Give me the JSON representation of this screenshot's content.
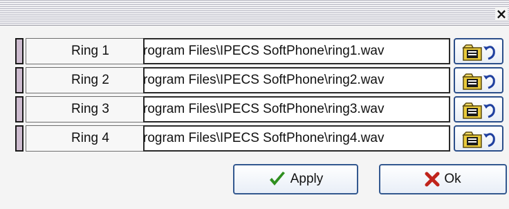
{
  "dialog": {
    "close_glyph": "×"
  },
  "rows": [
    {
      "label": "Ring 1",
      "path": "rogram Files\\IPECS SoftPhone\\ring1.wav"
    },
    {
      "label": "Ring 2",
      "path": "rogram Files\\IPECS SoftPhone\\ring2.wav"
    },
    {
      "label": "Ring 3",
      "path": "rogram Files\\IPECS SoftPhone\\ring3.wav"
    },
    {
      "label": "Ring 4",
      "path": "rogram Files\\IPECS SoftPhone\\ring4.wav"
    }
  ],
  "icons": {
    "browse": "folder-browse-icon",
    "apply": "checkmark-icon",
    "ok": "x-mark-icon",
    "apply_color": "#2f8f1f",
    "ok_color": "#c0241c"
  },
  "buttons": {
    "apply_label": "Apply",
    "ok_label": "Ok"
  }
}
